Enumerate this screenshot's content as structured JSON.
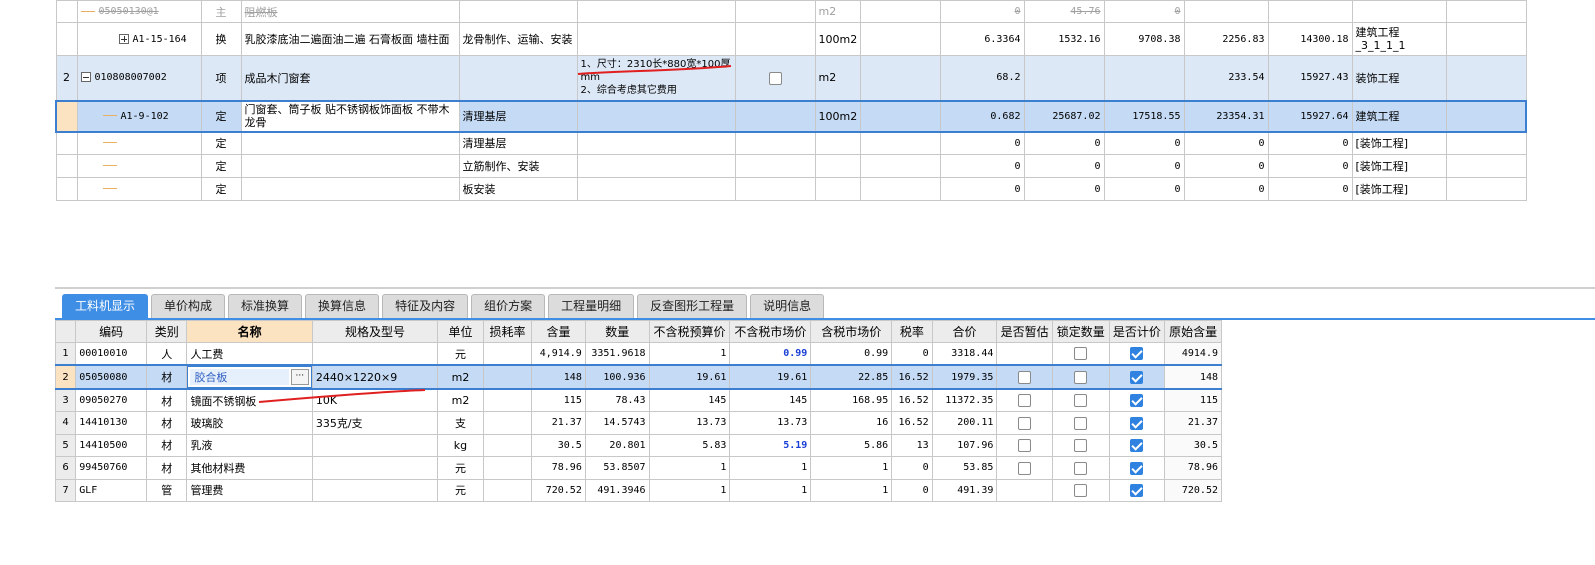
{
  "top_rows": [
    {
      "idx": "",
      "code": "05050130@1",
      "type": "主",
      "name": "阻燃板",
      "content": "",
      "feature": "",
      "unit": "m2",
      "qty": "0",
      "price": "45.76",
      "total": "0",
      "c2": "",
      "c3": "",
      "section": "",
      "struck": true
    },
    {
      "idx": "",
      "code": "A1-15-164",
      "type": "换",
      "name": "乳胶漆底油二遍面油二遍 石膏板面 墙柱面",
      "content": "龙骨制作、运输、安装",
      "feature": "",
      "unit": "100m2",
      "qty": "6.3364",
      "price": "1532.16",
      "total": "9708.38",
      "c2": "2256.83",
      "c3": "14300.18",
      "section": "建筑工程_3_1_1_1"
    },
    {
      "idx": "2",
      "code": "010808007002",
      "type": "项",
      "name": "成品木门窗套",
      "content": "",
      "feature": "1、尺寸：2310长*880宽*100厚mm\n2、综合考虑其它费用",
      "unit": "m2",
      "qty": "68.2",
      "price": "",
      "total": "",
      "c2": "233.54",
      "c3": "15927.43",
      "section": "装饰工程"
    },
    {
      "idx": "",
      "code": "A1-9-102",
      "type": "定",
      "name": "门窗套、筒子板 贴不锈钢板饰面板 不带木龙骨",
      "content": "清理基层",
      "feature": "",
      "unit": "100m2",
      "qty": "0.682",
      "price": "25687.02",
      "total": "17518.55",
      "c2": "23354.31",
      "c3": "15927.64",
      "section": "建筑工程"
    },
    {
      "idx": "",
      "code": "",
      "type": "定",
      "name": "",
      "content": "清理基层",
      "feature": "",
      "unit": "",
      "qty": "0",
      "price": "0",
      "total": "0",
      "c2": "0",
      "c3": "0",
      "section": "[装饰工程]"
    },
    {
      "idx": "",
      "code": "",
      "type": "定",
      "name": "",
      "content": "立筋制作、安装",
      "feature": "",
      "unit": "",
      "qty": "0",
      "price": "0",
      "total": "0",
      "c2": "0",
      "c3": "0",
      "section": "[装饰工程]"
    },
    {
      "idx": "",
      "code": "",
      "type": "定",
      "name": "",
      "content": "板安装",
      "feature": "",
      "unit": "",
      "qty": "0",
      "price": "0",
      "total": "0",
      "c2": "0",
      "c3": "0",
      "section": "[装饰工程]"
    }
  ],
  "tabs": [
    "工料机显示",
    "单价构成",
    "标准换算",
    "换算信息",
    "特征及内容",
    "组价方案",
    "工程量明细",
    "反查图形工程量",
    "说明信息"
  ],
  "bottom_headers": [
    "",
    "编码",
    "类别",
    "名称",
    "规格及型号",
    "单位",
    "损耗率",
    "含量",
    "数量",
    "不含税预算价",
    "不含税市场价",
    "含税市场价",
    "税率",
    "合价",
    "是否暂估",
    "锁定数量",
    "是否计价",
    "原始含量"
  ],
  "bottom_rows": [
    {
      "n": "1",
      "code": "00010010",
      "cat": "人",
      "name": "人工费",
      "spec": "",
      "unit": "元",
      "loss": "",
      "content": "4,914.9",
      "qty": "3351.9618",
      "budget": "1",
      "market": "0.99",
      "market_blue": true,
      "taxed": "0.99",
      "rate": "0",
      "total": "3318.44",
      "est": null,
      "lock": false,
      "priced": true,
      "orig": "4914.9"
    },
    {
      "n": "2",
      "code": "05050080",
      "cat": "材",
      "name": "胶合板",
      "spec": "2440×1220×9",
      "unit": "m2",
      "loss": "",
      "content": "148",
      "qty": "100.936",
      "budget": "19.61",
      "market": "19.61",
      "market_blue": false,
      "taxed": "22.85",
      "rate": "16.52",
      "total": "1979.35",
      "est": false,
      "lock": false,
      "priced": true,
      "orig": "148"
    },
    {
      "n": "3",
      "code": "09050270",
      "cat": "材",
      "name": "镜面不锈钢板",
      "spec": "10K",
      "unit": "m2",
      "loss": "",
      "content": "115",
      "qty": "78.43",
      "budget": "145",
      "market": "145",
      "market_blue": false,
      "taxed": "168.95",
      "rate": "16.52",
      "total": "11372.35",
      "est": false,
      "lock": false,
      "priced": true,
      "orig": "115"
    },
    {
      "n": "4",
      "code": "14410130",
      "cat": "材",
      "name": "玻璃胶",
      "spec": "335克/支",
      "unit": "支",
      "loss": "",
      "content": "21.37",
      "qty": "14.5743",
      "budget": "13.73",
      "market": "13.73",
      "market_blue": false,
      "taxed": "16",
      "rate": "16.52",
      "total": "200.11",
      "est": false,
      "lock": false,
      "priced": true,
      "orig": "21.37"
    },
    {
      "n": "5",
      "code": "14410500",
      "cat": "材",
      "name": "乳液",
      "spec": "",
      "unit": "kg",
      "loss": "",
      "content": "30.5",
      "qty": "20.801",
      "budget": "5.83",
      "market": "5.19",
      "market_blue": true,
      "taxed": "5.86",
      "rate": "13",
      "total": "107.96",
      "est": false,
      "lock": false,
      "priced": true,
      "orig": "30.5"
    },
    {
      "n": "6",
      "code": "99450760",
      "cat": "材",
      "name": "其他材料费",
      "spec": "",
      "unit": "元",
      "loss": "",
      "content": "78.96",
      "qty": "53.8507",
      "budget": "1",
      "market": "1",
      "market_blue": false,
      "taxed": "1",
      "rate": "0",
      "total": "53.85",
      "est": false,
      "lock": false,
      "priced": true,
      "orig": "78.96"
    },
    {
      "n": "7",
      "code": "GLF",
      "cat": "管",
      "name": "管理费",
      "spec": "",
      "unit": "元",
      "loss": "",
      "content": "720.52",
      "qty": "491.3946",
      "budget": "1",
      "market": "1",
      "market_blue": false,
      "taxed": "1",
      "rate": "0",
      "total": "491.39",
      "est": null,
      "lock": false,
      "priced": true,
      "orig": "720.52"
    }
  ],
  "colors": {
    "accent": "#3e8ee6",
    "selection": "#c5dbf5",
    "header_highlight": "#fbe3c2",
    "annotation": "#e02020",
    "blue_value": "#1a3fd6"
  }
}
